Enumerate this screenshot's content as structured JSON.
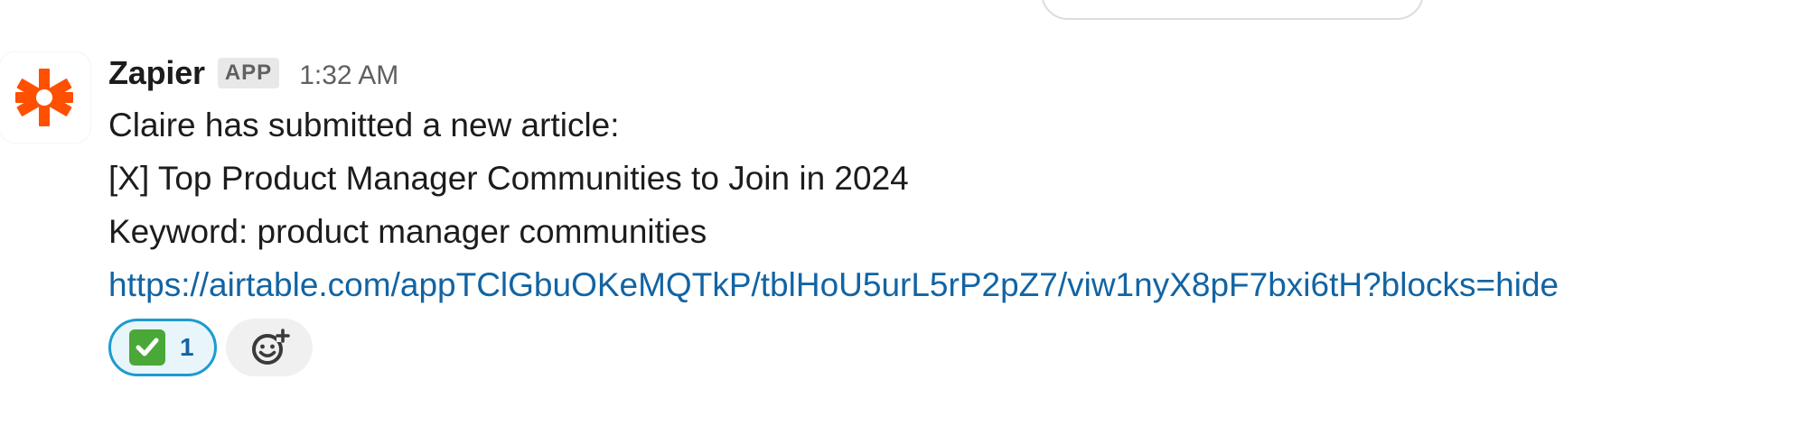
{
  "message": {
    "sender": "Zapier",
    "badge": "APP",
    "time": "1:32 AM",
    "lines": [
      "Claire has submitted a new article:",
      "[X] Top Product Manager Communities to Join in 2024",
      "Keyword: product manager communities"
    ],
    "link": "https://airtable.com/appTClGbuOKeMQTkP/tblHoU5urL5rP2pZ7/viw1nyX8pF7bxi6tH?blocks=hide"
  },
  "reactions": [
    {
      "emoji": "white-check-mark-icon",
      "count": "1",
      "selected": true
    }
  ],
  "icons": {
    "avatar": "zapier-asterisk-icon",
    "add_reaction": "add-reaction-icon"
  },
  "colors": {
    "brand": "#ff4f00",
    "link": "#1264a3",
    "reaction_border": "#1d9bd1",
    "reaction_bg": "#e8f5fa",
    "check_green": "#4aa838"
  }
}
